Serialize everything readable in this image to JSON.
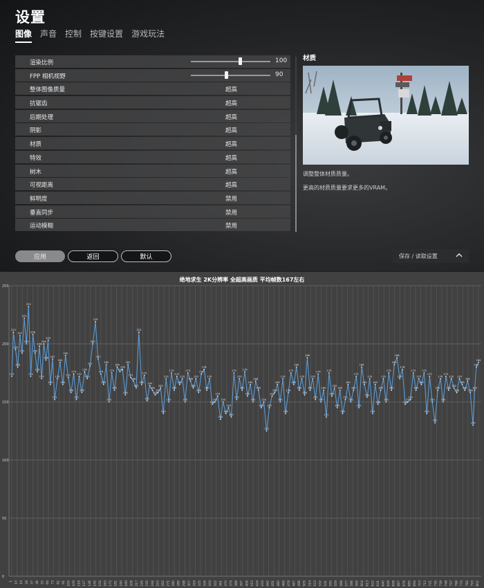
{
  "settings": {
    "title": "设置",
    "tabs": [
      {
        "label": "图像",
        "active": true
      },
      {
        "label": "声音"
      },
      {
        "label": "控制"
      },
      {
        "label": "按键设置"
      },
      {
        "label": "游戏玩法"
      }
    ],
    "rows": [
      {
        "label": "渲染比例",
        "type": "slider",
        "value": "100",
        "level": 0.62
      },
      {
        "label": "FPP 相机视野",
        "type": "slider",
        "value": "90",
        "level": 0.44
      },
      {
        "label": "整体图像质量",
        "type": "select",
        "value": "超高"
      },
      {
        "label": "抗锯齿",
        "type": "select",
        "value": "超高"
      },
      {
        "label": "后期处理",
        "type": "select",
        "value": "超高"
      },
      {
        "label": "阴影",
        "type": "select",
        "value": "超高"
      },
      {
        "label": "材质",
        "type": "select",
        "value": "超高"
      },
      {
        "label": "特效",
        "type": "select",
        "value": "超高"
      },
      {
        "label": "树木",
        "type": "select",
        "value": "超高"
      },
      {
        "label": "可视距离",
        "type": "select",
        "value": "超高"
      },
      {
        "label": "鲜明度",
        "type": "select",
        "value": "禁用"
      },
      {
        "label": "垂直同步",
        "type": "select",
        "value": "禁用"
      },
      {
        "label": "运动模糊",
        "type": "select",
        "value": "禁用"
      }
    ],
    "panel": {
      "title": "材质",
      "desc1": "调整整体材质质量。",
      "desc2": "更高的材质质量要求更多的VRAM。",
      "preview_icon": "snow-scene-jeep-image"
    },
    "buttons": {
      "apply": "应用",
      "back": "返回",
      "default": "默认"
    },
    "save_load": "保存 / 读取设置"
  },
  "chart_data": {
    "type": "line",
    "title": "绝地求生 2K分辨率 全超高画质 平均帧数167左右",
    "ylim": [
      0,
      250
    ],
    "y_ticks": [
      0,
      50,
      100,
      150,
      200,
      250
    ],
    "grid": true,
    "color": "#5b9bd5",
    "x_tick_labels": [
      "1",
      "10",
      "19",
      "28",
      "37",
      "46",
      "55",
      "64",
      "73",
      "82",
      "91",
      "100",
      "109",
      "118",
      "127",
      "136",
      "145",
      "154",
      "163",
      "172",
      "181",
      "190",
      "199",
      "208",
      "217",
      "226",
      "235",
      "244",
      "253",
      "262",
      "271",
      "280",
      "289",
      "298",
      "307",
      "316",
      "325",
      "334",
      "343",
      "352",
      "361",
      "370",
      "379",
      "388",
      "397",
      "406",
      "415",
      "424",
      "433",
      "442",
      "451",
      "460",
      "469",
      "478",
      "487",
      "496",
      "505",
      "514",
      "523",
      "532",
      "541",
      "550",
      "559",
      "568",
      "577",
      "586",
      "595",
      "604",
      "613",
      "622",
      "631",
      "640",
      "649",
      "658",
      "667",
      "676",
      "685",
      "694",
      "703",
      "712",
      "721",
      "730",
      "739",
      "748",
      "757",
      "766",
      "775",
      "784",
      "793",
      "802"
    ],
    "keypoints": [
      [
        1,
        172
      ],
      [
        4,
        210
      ],
      [
        8,
        195
      ],
      [
        12,
        180
      ],
      [
        16,
        207
      ],
      [
        20,
        192
      ],
      [
        24,
        222
      ],
      [
        28,
        200
      ],
      [
        32,
        232
      ],
      [
        36,
        172
      ],
      [
        40,
        208
      ],
      [
        44,
        192
      ],
      [
        48,
        176
      ],
      [
        52,
        198
      ],
      [
        56,
        170
      ],
      [
        60,
        200
      ],
      [
        64,
        186
      ],
      [
        68,
        203
      ],
      [
        72,
        165
      ],
      [
        76,
        187
      ],
      [
        80,
        152
      ],
      [
        85,
        170
      ],
      [
        90,
        184
      ],
      [
        95,
        165
      ],
      [
        100,
        190
      ],
      [
        105,
        171
      ],
      [
        110,
        158
      ],
      [
        115,
        174
      ],
      [
        120,
        152
      ],
      [
        125,
        172
      ],
      [
        130,
        158
      ],
      [
        135,
        176
      ],
      [
        140,
        170
      ],
      [
        145,
        181
      ],
      [
        150,
        200
      ],
      [
        155,
        219
      ],
      [
        160,
        187
      ],
      [
        165,
        174
      ],
      [
        170,
        165
      ],
      [
        175,
        182
      ],
      [
        180,
        150
      ],
      [
        185,
        175
      ],
      [
        190,
        160
      ],
      [
        195,
        180
      ],
      [
        200,
        176
      ],
      [
        205,
        178
      ],
      [
        210,
        156
      ],
      [
        215,
        182
      ],
      [
        220,
        171
      ],
      [
        225,
        168
      ],
      [
        230,
        162
      ],
      [
        235,
        210
      ],
      [
        240,
        165
      ],
      [
        245,
        173
      ],
      [
        250,
        151
      ],
      [
        255,
        164
      ],
      [
        260,
        160
      ],
      [
        265,
        156
      ],
      [
        270,
        158
      ],
      [
        275,
        162
      ],
      [
        280,
        140
      ],
      [
        285,
        170
      ],
      [
        290,
        150
      ],
      [
        295,
        175
      ],
      [
        300,
        160
      ],
      [
        305,
        172
      ],
      [
        310,
        165
      ],
      [
        315,
        170
      ],
      [
        320,
        150
      ],
      [
        325,
        175
      ],
      [
        330,
        168
      ],
      [
        335,
        162
      ],
      [
        340,
        170
      ],
      [
        345,
        158
      ],
      [
        350,
        174
      ],
      [
        355,
        178
      ],
      [
        360,
        160
      ],
      [
        365,
        170
      ],
      [
        370,
        148
      ],
      [
        375,
        150
      ],
      [
        380,
        155
      ],
      [
        385,
        135
      ],
      [
        390,
        150
      ],
      [
        395,
        140
      ],
      [
        400,
        145
      ],
      [
        405,
        137
      ],
      [
        410,
        175
      ],
      [
        415,
        152
      ],
      [
        420,
        170
      ],
      [
        425,
        160
      ],
      [
        430,
        176
      ],
      [
        435,
        155
      ],
      [
        440,
        165
      ],
      [
        445,
        150
      ],
      [
        450,
        168
      ],
      [
        455,
        160
      ],
      [
        460,
        145
      ],
      [
        465,
        150
      ],
      [
        470,
        125
      ],
      [
        475,
        145
      ],
      [
        480,
        155
      ],
      [
        485,
        158
      ],
      [
        490,
        165
      ],
      [
        495,
        150
      ],
      [
        500,
        170
      ],
      [
        505,
        140
      ],
      [
        510,
        158
      ],
      [
        515,
        175
      ],
      [
        520,
        165
      ],
      [
        525,
        180
      ],
      [
        530,
        160
      ],
      [
        535,
        170
      ],
      [
        540,
        156
      ],
      [
        545,
        188
      ],
      [
        550,
        160
      ],
      [
        555,
        170
      ],
      [
        560,
        152
      ],
      [
        565,
        174
      ],
      [
        570,
        150
      ],
      [
        575,
        160
      ],
      [
        580,
        137
      ],
      [
        585,
        175
      ],
      [
        590,
        155
      ],
      [
        595,
        162
      ],
      [
        600,
        145
      ],
      [
        605,
        160
      ],
      [
        610,
        140
      ],
      [
        615,
        152
      ],
      [
        620,
        165
      ],
      [
        625,
        150
      ],
      [
        630,
        160
      ],
      [
        635,
        172
      ],
      [
        640,
        145
      ],
      [
        645,
        180
      ],
      [
        650,
        165
      ],
      [
        655,
        154
      ],
      [
        660,
        170
      ],
      [
        665,
        140
      ],
      [
        670,
        165
      ],
      [
        675,
        148
      ],
      [
        680,
        160
      ],
      [
        685,
        170
      ],
      [
        690,
        150
      ],
      [
        695,
        175
      ],
      [
        700,
        160
      ],
      [
        705,
        182
      ],
      [
        710,
        188
      ],
      [
        715,
        170
      ],
      [
        720,
        178
      ],
      [
        725,
        148
      ],
      [
        730,
        150
      ],
      [
        735,
        152
      ],
      [
        740,
        175
      ],
      [
        745,
        160
      ],
      [
        750,
        170
      ],
      [
        755,
        165
      ],
      [
        760,
        175
      ],
      [
        765,
        140
      ],
      [
        770,
        172
      ],
      [
        775,
        150
      ],
      [
        780,
        132
      ],
      [
        785,
        160
      ],
      [
        790,
        170
      ],
      [
        795,
        150
      ],
      [
        800,
        172
      ],
      [
        805,
        160
      ],
      [
        810,
        170
      ],
      [
        815,
        162
      ],
      [
        820,
        158
      ],
      [
        825,
        170
      ],
      [
        830,
        165
      ],
      [
        835,
        160
      ],
      [
        840,
        168
      ],
      [
        845,
        158
      ],
      [
        850,
        130
      ],
      [
        853,
        160
      ],
      [
        856,
        180
      ],
      [
        860,
        184
      ]
    ]
  }
}
